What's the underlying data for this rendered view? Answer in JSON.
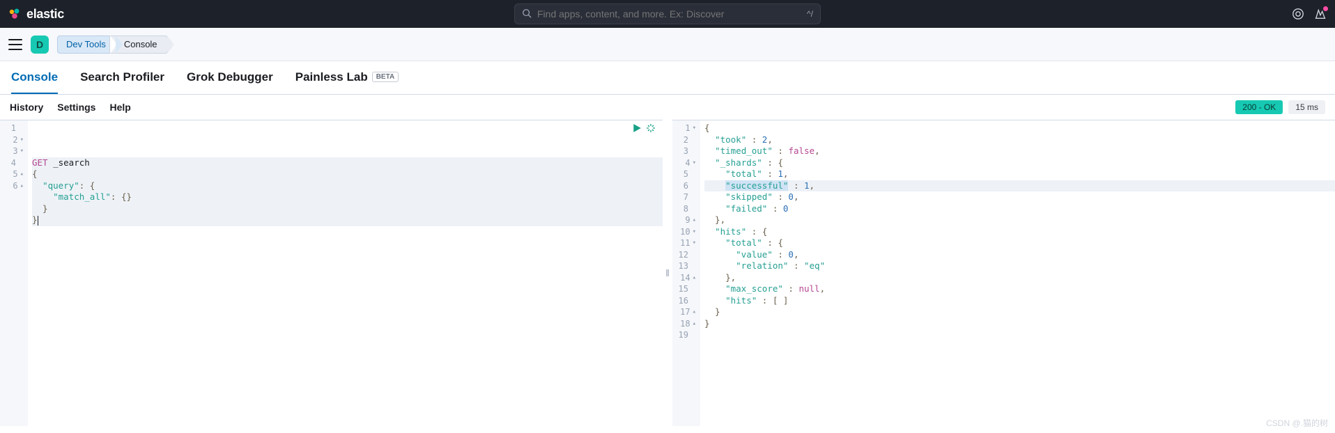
{
  "header": {
    "brand": "elastic",
    "search_placeholder": "Find apps, content, and more. Ex: Discover",
    "search_shortcut": "^/"
  },
  "space": {
    "letter": "D"
  },
  "breadcrumb": {
    "items": [
      "Dev Tools",
      "Console"
    ]
  },
  "tabs": {
    "items": [
      "Console",
      "Search Profiler",
      "Grok Debugger",
      "Painless Lab"
    ],
    "active": "Console",
    "beta_label": "BETA"
  },
  "toolbar": {
    "links": [
      "History",
      "Settings",
      "Help"
    ],
    "status": "200 - OK",
    "time": "15 ms"
  },
  "request": {
    "method": "GET",
    "path": "_search",
    "lines": [
      {
        "n": 1,
        "fold": "",
        "segs": [
          {
            "t": "GET ",
            "c": "m"
          },
          {
            "t": "_search",
            "c": ""
          }
        ]
      },
      {
        "n": 2,
        "fold": "▾",
        "segs": [
          {
            "t": "{",
            "c": "p"
          }
        ]
      },
      {
        "n": 3,
        "fold": "▾",
        "segs": [
          {
            "t": "  ",
            "c": ""
          },
          {
            "t": "\"query\"",
            "c": "s"
          },
          {
            "t": ": {",
            "c": "p"
          }
        ]
      },
      {
        "n": 4,
        "fold": "",
        "segs": [
          {
            "t": "    ",
            "c": ""
          },
          {
            "t": "\"match_all\"",
            "c": "s"
          },
          {
            "t": ": {}",
            "c": "p"
          }
        ]
      },
      {
        "n": 5,
        "fold": "▴",
        "segs": [
          {
            "t": "  }",
            "c": "p"
          }
        ]
      },
      {
        "n": 6,
        "fold": "▴",
        "segs": [
          {
            "t": "}",
            "c": "p"
          }
        ],
        "cursor": true
      }
    ]
  },
  "response": {
    "lines": [
      {
        "n": 1,
        "fold": "▾",
        "segs": [
          {
            "t": "{",
            "c": "p"
          }
        ]
      },
      {
        "n": 2,
        "fold": "",
        "segs": [
          {
            "t": "  ",
            "c": ""
          },
          {
            "t": "\"took\"",
            "c": "s"
          },
          {
            "t": " : ",
            "c": "p"
          },
          {
            "t": "2",
            "c": "n"
          },
          {
            "t": ",",
            "c": "p"
          }
        ]
      },
      {
        "n": 3,
        "fold": "",
        "segs": [
          {
            "t": "  ",
            "c": ""
          },
          {
            "t": "\"timed_out\"",
            "c": "s"
          },
          {
            "t": " : ",
            "c": "p"
          },
          {
            "t": "false",
            "c": "k"
          },
          {
            "t": ",",
            "c": "p"
          }
        ]
      },
      {
        "n": 4,
        "fold": "▾",
        "segs": [
          {
            "t": "  ",
            "c": ""
          },
          {
            "t": "\"_shards\"",
            "c": "s"
          },
          {
            "t": " : {",
            "c": "p"
          }
        ]
      },
      {
        "n": 5,
        "fold": "",
        "segs": [
          {
            "t": "    ",
            "c": ""
          },
          {
            "t": "\"total\"",
            "c": "s"
          },
          {
            "t": " : ",
            "c": "p"
          },
          {
            "t": "1",
            "c": "n"
          },
          {
            "t": ",",
            "c": "p"
          }
        ]
      },
      {
        "n": 6,
        "fold": "",
        "hl": true,
        "segs": [
          {
            "t": "    ",
            "c": ""
          },
          {
            "t": "\"successful\"",
            "c": "s",
            "sel": true
          },
          {
            "t": " : ",
            "c": "p"
          },
          {
            "t": "1",
            "c": "n"
          },
          {
            "t": ",",
            "c": "p"
          }
        ]
      },
      {
        "n": 7,
        "fold": "",
        "segs": [
          {
            "t": "    ",
            "c": ""
          },
          {
            "t": "\"skipped\"",
            "c": "s"
          },
          {
            "t": " : ",
            "c": "p"
          },
          {
            "t": "0",
            "c": "n"
          },
          {
            "t": ",",
            "c": "p"
          }
        ]
      },
      {
        "n": 8,
        "fold": "",
        "segs": [
          {
            "t": "    ",
            "c": ""
          },
          {
            "t": "\"failed\"",
            "c": "s"
          },
          {
            "t": " : ",
            "c": "p"
          },
          {
            "t": "0",
            "c": "n"
          }
        ]
      },
      {
        "n": 9,
        "fold": "▴",
        "segs": [
          {
            "t": "  },",
            "c": "p"
          }
        ]
      },
      {
        "n": 10,
        "fold": "▾",
        "segs": [
          {
            "t": "  ",
            "c": ""
          },
          {
            "t": "\"hits\"",
            "c": "s"
          },
          {
            "t": " : {",
            "c": "p"
          }
        ]
      },
      {
        "n": 11,
        "fold": "▾",
        "segs": [
          {
            "t": "    ",
            "c": ""
          },
          {
            "t": "\"total\"",
            "c": "s"
          },
          {
            "t": " : {",
            "c": "p"
          }
        ]
      },
      {
        "n": 12,
        "fold": "",
        "segs": [
          {
            "t": "      ",
            "c": ""
          },
          {
            "t": "\"value\"",
            "c": "s"
          },
          {
            "t": " : ",
            "c": "p"
          },
          {
            "t": "0",
            "c": "n"
          },
          {
            "t": ",",
            "c": "p"
          }
        ]
      },
      {
        "n": 13,
        "fold": "",
        "segs": [
          {
            "t": "      ",
            "c": ""
          },
          {
            "t": "\"relation\"",
            "c": "s"
          },
          {
            "t": " : ",
            "c": "p"
          },
          {
            "t": "\"eq\"",
            "c": "s"
          }
        ]
      },
      {
        "n": 14,
        "fold": "▴",
        "segs": [
          {
            "t": "    },",
            "c": "p"
          }
        ]
      },
      {
        "n": 15,
        "fold": "",
        "segs": [
          {
            "t": "    ",
            "c": ""
          },
          {
            "t": "\"max_score\"",
            "c": "s"
          },
          {
            "t": " : ",
            "c": "p"
          },
          {
            "t": "null",
            "c": "k"
          },
          {
            "t": ",",
            "c": "p"
          }
        ]
      },
      {
        "n": 16,
        "fold": "",
        "segs": [
          {
            "t": "    ",
            "c": ""
          },
          {
            "t": "\"hits\"",
            "c": "s"
          },
          {
            "t": " : [ ]",
            "c": "p"
          }
        ]
      },
      {
        "n": 17,
        "fold": "▴",
        "segs": [
          {
            "t": "  }",
            "c": "p"
          }
        ]
      },
      {
        "n": 18,
        "fold": "▴",
        "segs": [
          {
            "t": "}",
            "c": "p"
          }
        ]
      },
      {
        "n": 19,
        "fold": "",
        "segs": []
      }
    ]
  },
  "watermark": "CSDN @.猫的树"
}
